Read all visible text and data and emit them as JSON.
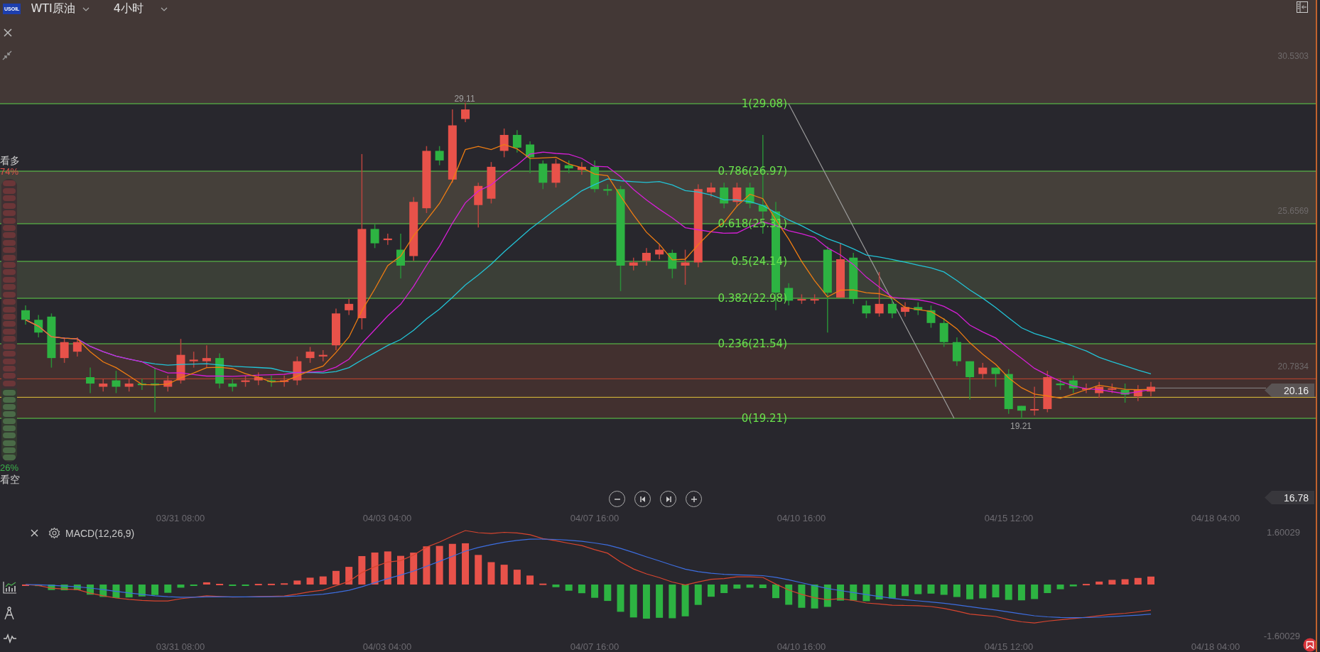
{
  "header": {
    "symbol_badge": "USOIL",
    "symbol": "WTI原油",
    "timeframe": "4小时"
  },
  "sentiment": {
    "bull_label": "看多",
    "bull_percent": "74%",
    "level": 0.74,
    "bear_percent": "26%",
    "bear_label": "看空"
  },
  "chart": {
    "high_label": "29.11",
    "low_label": "19.21",
    "fibonacci": [
      {
        "label": "1(29.08)"
      },
      {
        "label": "0.786(26.97)"
      },
      {
        "label": "0.618(25.31)"
      },
      {
        "label": "0.5(24.14)"
      },
      {
        "label": "0.382(22.98)"
      },
      {
        "label": "0.236(21.54)"
      },
      {
        "label": "0(19.21)"
      }
    ],
    "price_axis": [
      "30.5303",
      "25.6569",
      "20.7834"
    ],
    "current_price": "20.16",
    "cursor_price": "16.78",
    "time_axis": [
      "03/31 08:00",
      "04/03 04:00",
      "04/07 16:00",
      "04/10 16:00",
      "04/15 12:00",
      "04/18 04:00"
    ]
  },
  "macd": {
    "title": "MACD(12,26,9)",
    "axis": [
      "1.60029",
      "-1.60029"
    ],
    "time_axis": [
      "03/31 08:00",
      "04/03 04:00",
      "04/07 16:00",
      "04/10 16:00",
      "04/15 12:00",
      "04/18 04:00"
    ]
  }
}
